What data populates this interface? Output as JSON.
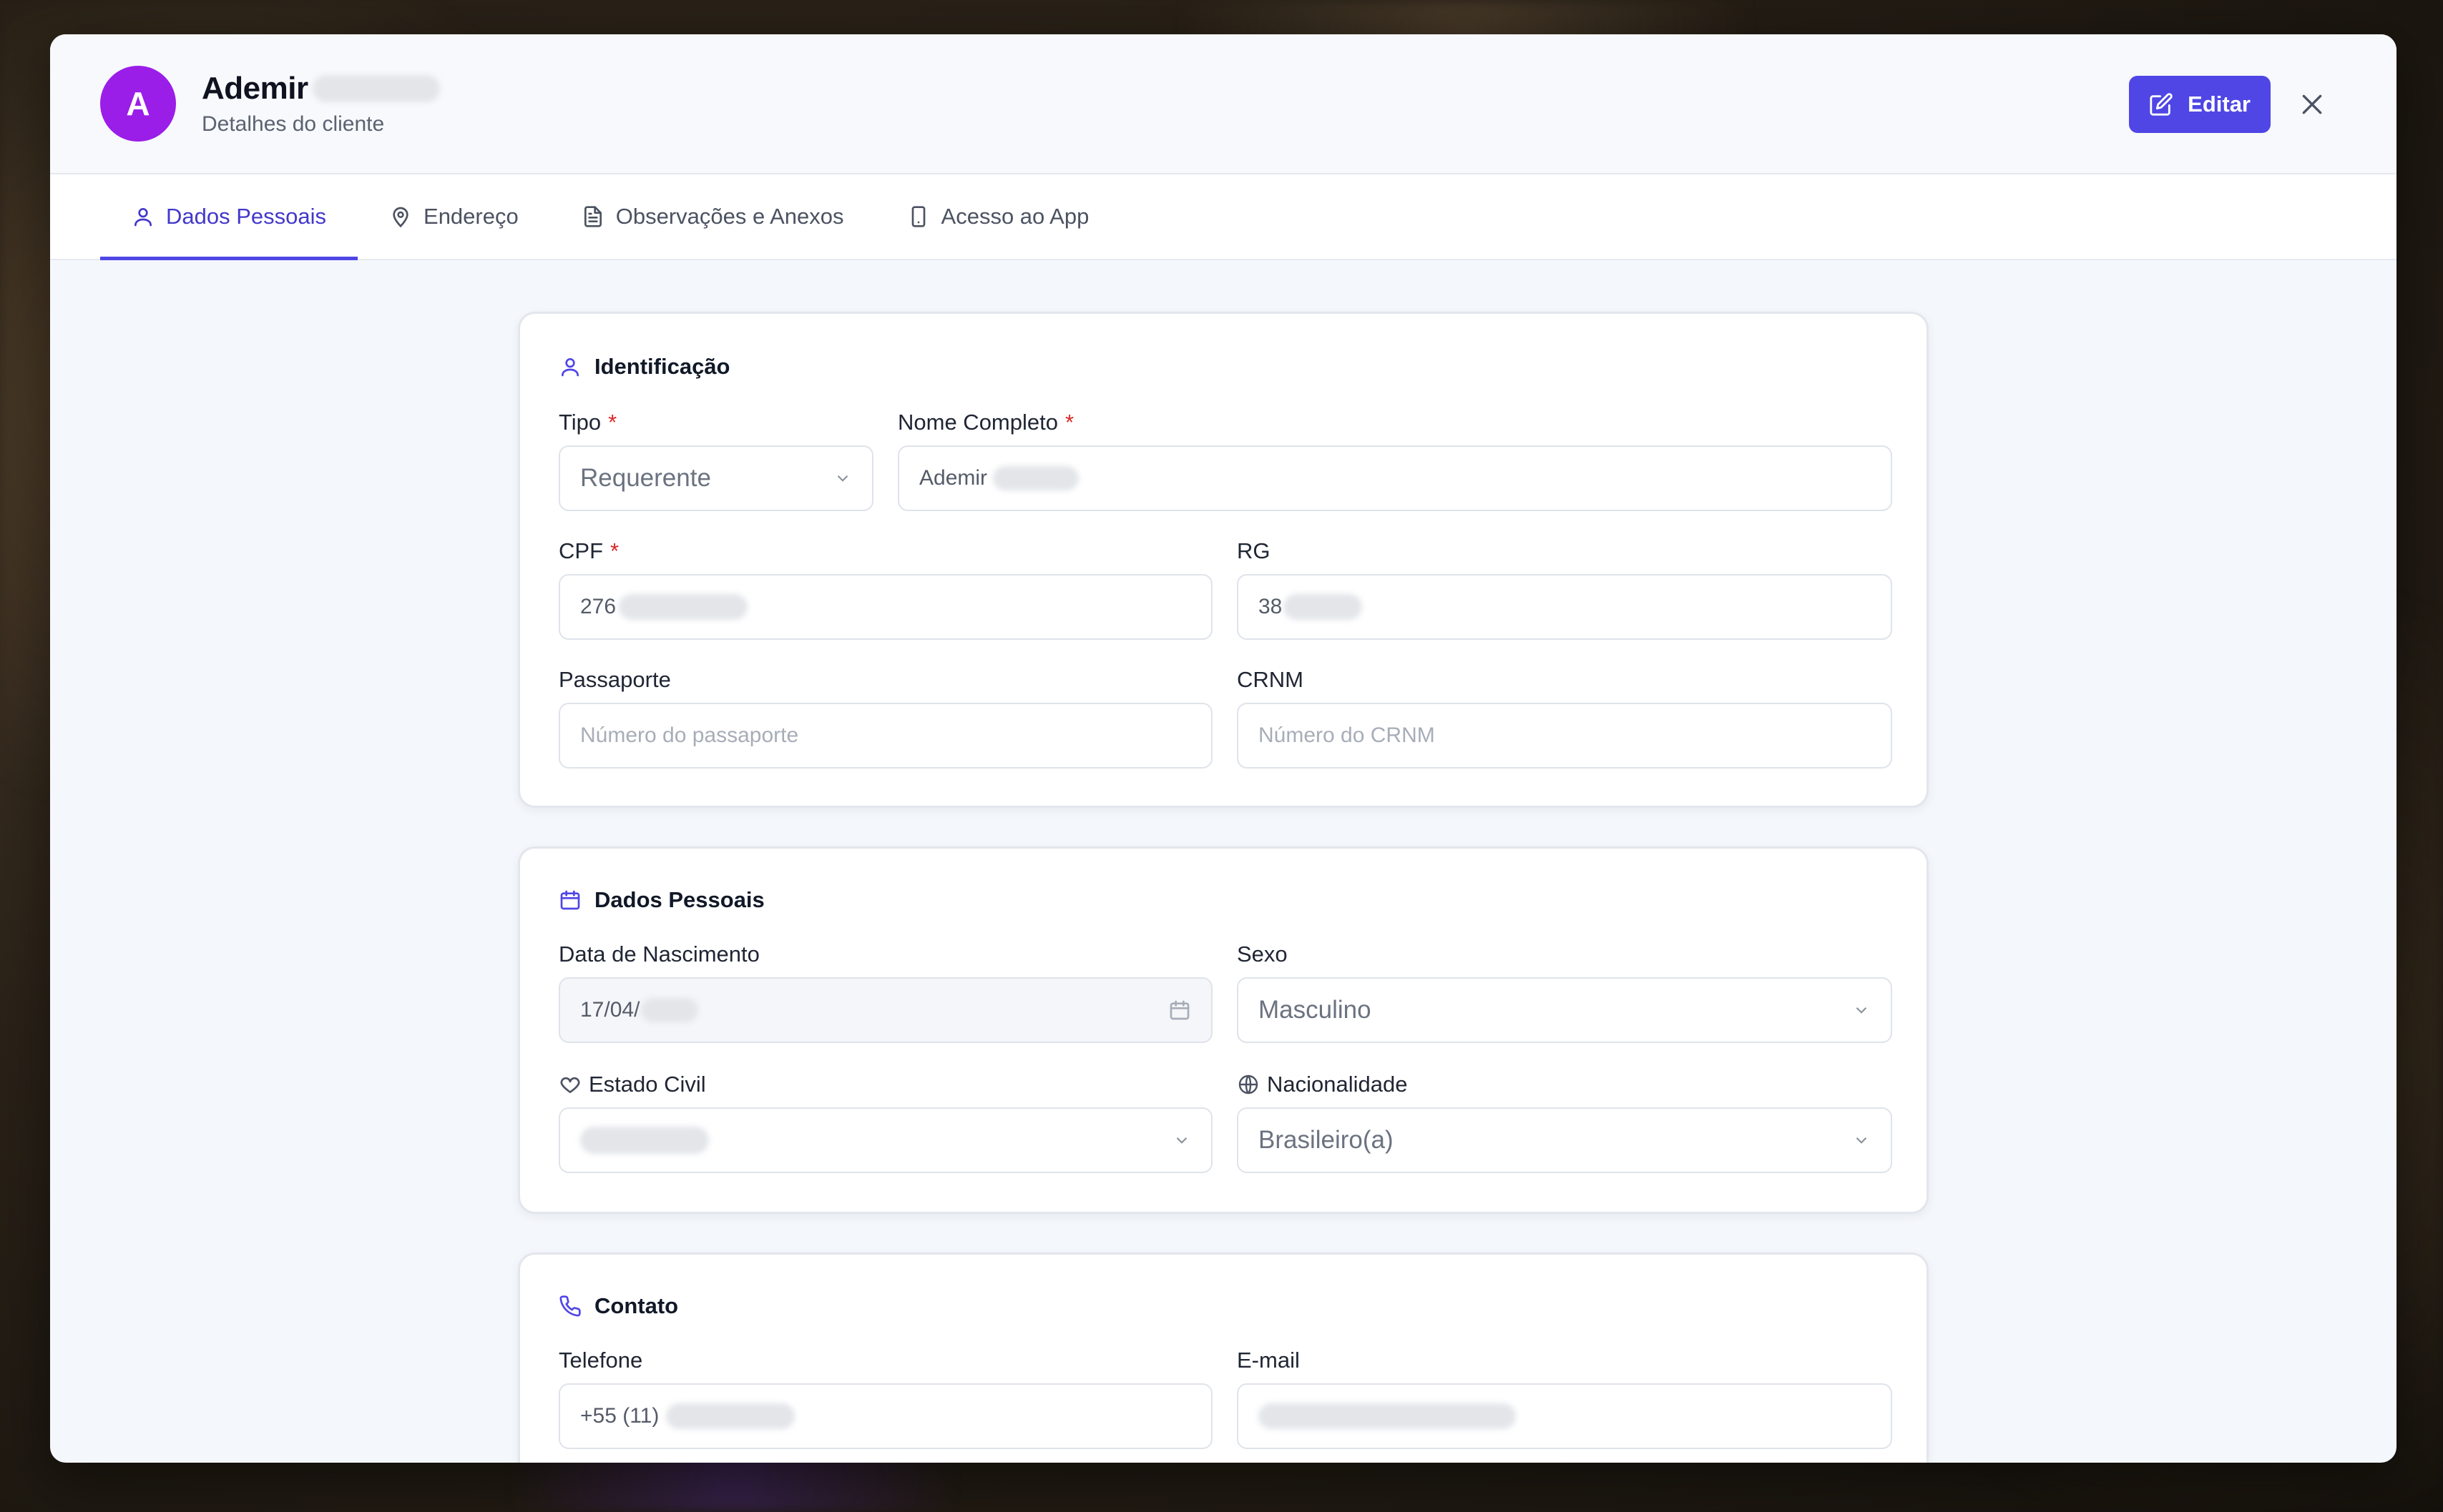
{
  "header": {
    "avatar_initial": "A",
    "client_name": "Ademir",
    "subtitle": "Detalhes do cliente",
    "edit_label": "Editar"
  },
  "tabs": [
    {
      "label": "Dados Pessoais",
      "icon": "user-icon",
      "active": true
    },
    {
      "label": "Endereço",
      "icon": "map-pin-icon",
      "active": false
    },
    {
      "label": "Observações e Anexos",
      "icon": "document-icon",
      "active": false
    },
    {
      "label": "Acesso ao App",
      "icon": "smartphone-icon",
      "active": false
    }
  ],
  "identificacao": {
    "title": "Identificação",
    "tipo_label": "Tipo",
    "tipo_value": "Requerente",
    "nome_label": "Nome Completo",
    "nome_value": "Ademir",
    "cpf_label": "CPF",
    "cpf_value": "276",
    "rg_label": "RG",
    "rg_value": "38",
    "passaporte_label": "Passaporte",
    "passaporte_placeholder": "Número do passaporte",
    "crnm_label": "CRNM",
    "crnm_placeholder": "Número do CRNM",
    "required_mark": "*"
  },
  "dados_pessoais": {
    "title": "Dados Pessoais",
    "nascimento_label": "Data de Nascimento",
    "nascimento_value": "17/04/",
    "sexo_label": "Sexo",
    "sexo_value": "Masculino",
    "estado_civil_label": "Estado Civil",
    "nacionalidade_label": "Nacionalidade",
    "nacionalidade_value": "Brasileiro(a)"
  },
  "contato": {
    "title": "Contato",
    "telefone_label": "Telefone",
    "telefone_value": "+55 (11)",
    "email_label": "E-mail"
  },
  "colors": {
    "accent": "#4f46e5",
    "avatar": "#9b1de8",
    "required": "#dc2626"
  }
}
